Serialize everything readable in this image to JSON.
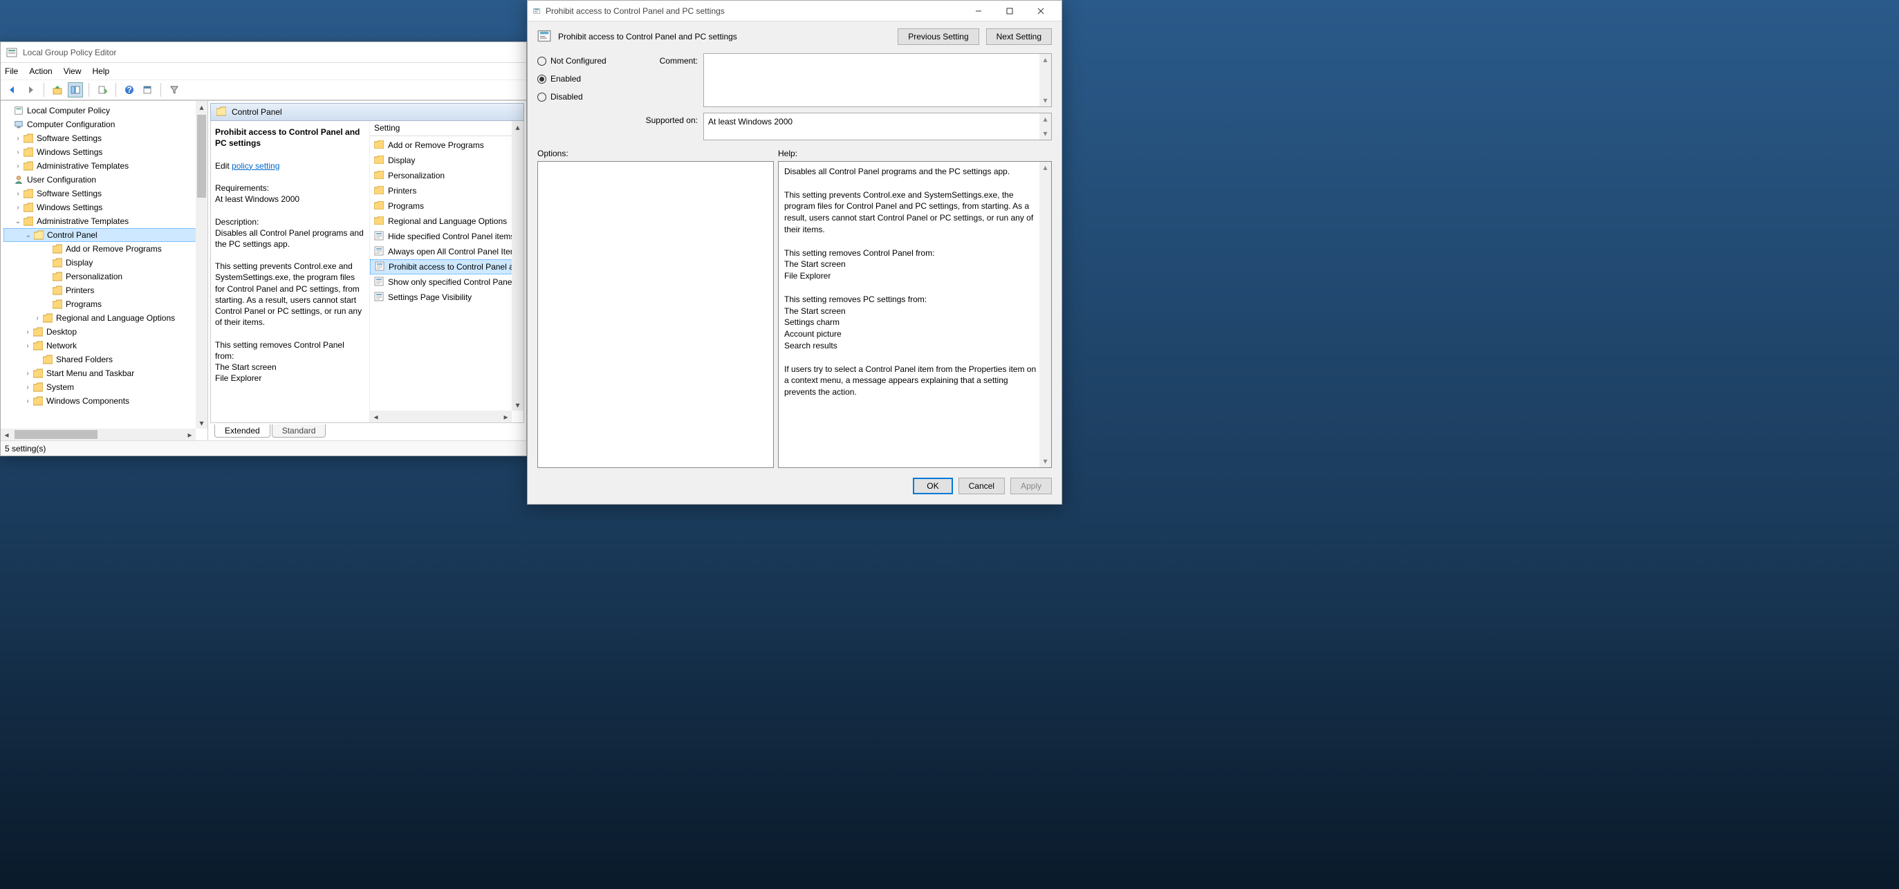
{
  "gpedit": {
    "title": "Local Group Policy Editor",
    "menu": {
      "file": "File",
      "action": "Action",
      "view": "View",
      "help": "Help"
    },
    "tree": {
      "root": "Local Computer Policy",
      "computer_config": "Computer Configuration",
      "cc_software": "Software Settings",
      "cc_windows": "Windows Settings",
      "cc_admin": "Administrative Templates",
      "user_config": "User Configuration",
      "uc_software": "Software Settings",
      "uc_windows": "Windows Settings",
      "uc_admin": "Administrative Templates",
      "control_panel": "Control Panel",
      "cp_add_remove": "Add or Remove Programs",
      "cp_display": "Display",
      "cp_personalization": "Personalization",
      "cp_printers": "Printers",
      "cp_programs": "Programs",
      "cp_regional": "Regional and Language Options",
      "desktop": "Desktop",
      "network": "Network",
      "shared_folders": "Shared Folders",
      "start_menu": "Start Menu and Taskbar",
      "system": "System",
      "windows_components": "Windows Components"
    },
    "header_label": "Control Panel",
    "detail": {
      "title": "Prohibit access to Control Panel and PC settings",
      "edit_prefix": "Edit ",
      "edit_link": "policy setting",
      "req_label": "Requirements:",
      "req_value": "At least Windows 2000",
      "desc_label": "Description:",
      "desc_body": "Disables all Control Panel programs and the PC settings app.\n\nThis setting prevents Control.exe and SystemSettings.exe, the program files for Control Panel and PC settings, from starting. As a result, users cannot start Control Panel or PC settings, or run any of their items.\n\nThis setting removes Control Panel from:\nThe Start screen\nFile Explorer"
    },
    "list": {
      "col": "Setting",
      "items": [
        {
          "type": "folder",
          "label": "Add or Remove Programs"
        },
        {
          "type": "folder",
          "label": "Display"
        },
        {
          "type": "folder",
          "label": "Personalization"
        },
        {
          "type": "folder",
          "label": "Printers"
        },
        {
          "type": "folder",
          "label": "Programs"
        },
        {
          "type": "folder",
          "label": "Regional and Language Options"
        },
        {
          "type": "setting",
          "label": "Hide specified Control Panel items"
        },
        {
          "type": "setting",
          "label": "Always open All Control Panel Items when opening Control Panel"
        },
        {
          "type": "setting",
          "label": "Prohibit access to Control Panel and PC settings",
          "selected": true
        },
        {
          "type": "setting",
          "label": "Show only specified Control Panel items"
        },
        {
          "type": "setting",
          "label": "Settings Page Visibility"
        }
      ]
    },
    "tabs": {
      "extended": "Extended",
      "standard": "Standard"
    },
    "status": "5 setting(s)"
  },
  "dialog": {
    "title": "Prohibit access to Control Panel and PC settings",
    "header": "Prohibit access to Control Panel and PC settings",
    "prev": "Previous Setting",
    "next": "Next Setting",
    "radio": {
      "not_configured": "Not Configured",
      "enabled": "Enabled",
      "disabled": "Disabled"
    },
    "selected_radio": "enabled",
    "comment_label": "Comment:",
    "comment_value": "",
    "supported_label": "Supported on:",
    "supported_value": "At least Windows 2000",
    "options_label": "Options:",
    "help_label": "Help:",
    "help_body": "Disables all Control Panel programs and the PC settings app.\n\nThis setting prevents Control.exe and SystemSettings.exe, the program files for Control Panel and PC settings, from starting. As a result, users cannot start Control Panel or PC settings, or run any of their items.\n\nThis setting removes Control Panel from:\nThe Start screen\nFile Explorer\n\nThis setting removes PC settings from:\nThe Start screen\nSettings charm\nAccount picture\nSearch results\n\nIf users try to select a Control Panel item from the Properties item on a context menu, a message appears explaining that a setting prevents the action.",
    "ok": "OK",
    "cancel": "Cancel",
    "apply": "Apply"
  }
}
